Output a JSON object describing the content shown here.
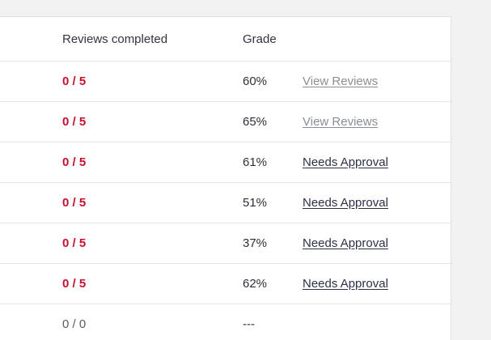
{
  "table": {
    "headers": {
      "reviews_completed": "Reviews completed",
      "grade": "Grade"
    },
    "rows": [
      {
        "reviews": "0 / 5",
        "grade": "60%",
        "action": "View Reviews",
        "action_style": "muted"
      },
      {
        "reviews": "0 / 5",
        "grade": "65%",
        "action": "View Reviews",
        "action_style": "muted"
      },
      {
        "reviews": "0 / 5",
        "grade": "61%",
        "action": "Needs Approval",
        "action_style": "strong"
      },
      {
        "reviews": "0 / 5",
        "grade": "51%",
        "action": "Needs Approval",
        "action_style": "strong"
      },
      {
        "reviews": "0 / 5",
        "grade": "37%",
        "action": "Needs Approval",
        "action_style": "strong"
      },
      {
        "reviews": "0 / 5",
        "grade": "62%",
        "action": "Needs Approval",
        "action_style": "strong"
      },
      {
        "reviews": "0 / 0",
        "grade": "---",
        "action": "",
        "action_style": "none"
      }
    ]
  },
  "colors": {
    "incomplete_count": "#c8102e",
    "link_muted": "#8a8e97",
    "link_strong": "#2b3146"
  }
}
